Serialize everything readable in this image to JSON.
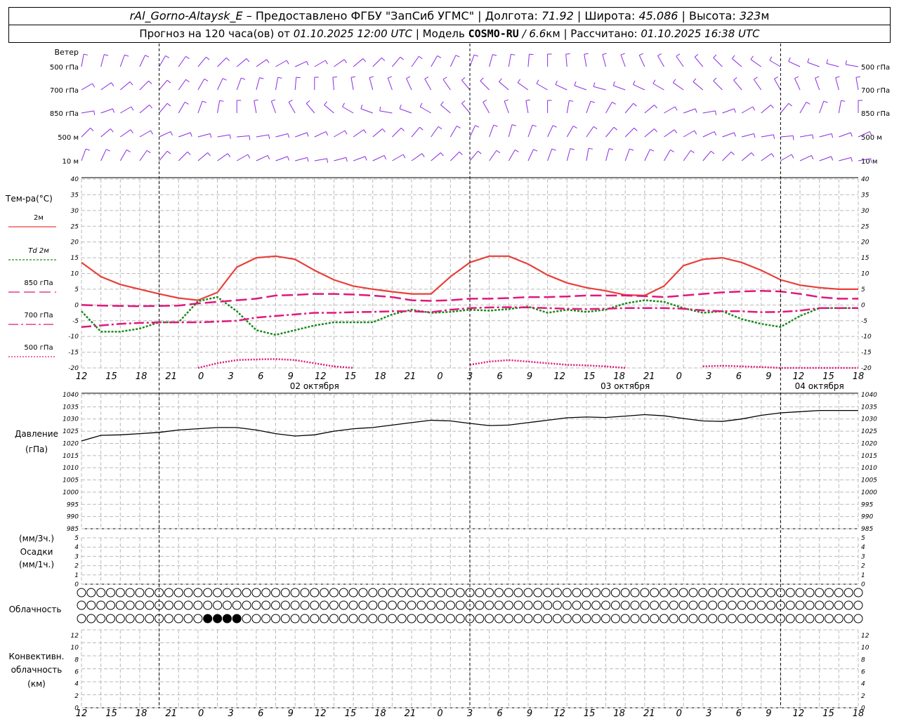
{
  "header": {
    "station": "rAl_Gorno-Altaysk_E",
    "provider": "–  Предоставлено ФГБУ \"ЗапСиб УГМС\"",
    "lon_label": "Долгота:",
    "lon_value": "71.92",
    "lat_label": "Широта:",
    "lat_value": "45.086",
    "alt_label": "Высота:",
    "alt_value": "323",
    "alt_unit": "м",
    "forecast_text": "Прогноз на 120 часа(ов) от",
    "forecast_start": "01.10.2025 12:00 UTC",
    "model_label": "Модель",
    "model_name": "COSMO-RU",
    "model_res": "/ 6.6",
    "model_res_unit": "км",
    "computed_label": "Рассчитано:",
    "computed_value": "01.10.2025 16:38 UTC"
  },
  "colors": {
    "wind": "#8a2be2",
    "t2m": "#e8403a",
    "td2m": "#1a8a1a",
    "t850": "#e0187a",
    "t700": "#e0187a",
    "t500": "#e0187a",
    "pressure": "#000000",
    "grid": "#bbbbbb"
  },
  "time_axis": {
    "hour_ticks": [
      "12",
      "15",
      "18",
      "21",
      "0",
      "3",
      "6",
      "9",
      "12",
      "15",
      "18",
      "21",
      "0",
      "3",
      "6",
      "9",
      "12",
      "15",
      "18",
      "21",
      "0",
      "3",
      "6",
      "9",
      "12",
      "15",
      "18"
    ],
    "day_labels": [
      "02 октября",
      "03 октября",
      "04 октября"
    ]
  },
  "wind_panel": {
    "title": "Ветер",
    "levels": [
      "500 гПа",
      "700 гПа",
      "850 гПа",
      "500 м",
      "10 м"
    ],
    "right_levels": [
      "500 гПа",
      "700 гПа",
      "850 гПа",
      "500 м",
      "10 м"
    ]
  },
  "temp_panel": {
    "title": "Тем-ра(°C)",
    "y_ticks": [
      "40",
      "35",
      "30",
      "25",
      "20",
      "15",
      "10",
      "5",
      "0",
      "-5",
      "-10",
      "-15",
      "-20"
    ],
    "legend": [
      {
        "label": "2м",
        "style": "solid"
      },
      {
        "label": "Td  2м",
        "style": "dotted"
      },
      {
        "label": "850 гПа",
        "style": "longdash"
      },
      {
        "label": "700 гПа",
        "style": "dashdot"
      },
      {
        "label": "500 гПа",
        "style": "fine-dotted"
      }
    ]
  },
  "pressure_panel": {
    "title": "Давление",
    "unit": "(гПа)",
    "y_ticks": [
      "1040",
      "1035",
      "1030",
      "1025",
      "1020",
      "1015",
      "1010",
      "1005",
      "1000",
      "995",
      "990",
      "985"
    ]
  },
  "precip_panel": {
    "unit_top": "(мм/3ч.)",
    "title": "Осадки",
    "unit_bottom": "(мм/1ч.)",
    "y_ticks": [
      "5",
      "4",
      "3",
      "2",
      "1",
      "0"
    ]
  },
  "cloud_panel": {
    "title": "Облачность",
    "filled_low": [
      13,
      14,
      15,
      16
    ]
  },
  "conv_panel": {
    "title_1": "Конвективн.",
    "title_2": "облачность",
    "unit": "(км)",
    "y_ticks": [
      "12",
      "10",
      "8",
      "6",
      "4",
      "2",
      "0"
    ]
  },
  "chart_data": [
    {
      "type": "line",
      "title": "Тем-ра(°C)",
      "x": [
        0,
        3,
        6,
        9,
        12,
        15,
        18,
        21,
        24,
        27,
        30,
        33,
        36,
        39,
        42,
        45,
        48,
        51,
        54,
        57,
        60,
        63,
        66,
        69,
        72,
        75,
        78,
        81,
        84,
        87,
        90,
        93,
        96,
        99,
        102,
        105,
        108,
        111,
        114,
        117,
        120
      ],
      "ylim": [
        -20,
        40
      ],
      "series": [
        {
          "name": "2м",
          "values": [
            13.5,
            9,
            6.5,
            5,
            3.5,
            2.2,
            1.5,
            4,
            12,
            15,
            15.5,
            14.5,
            11,
            8,
            6,
            5,
            4.2,
            3.5,
            3.5,
            9,
            13.5,
            15.5,
            15.5,
            13,
            9.5,
            7,
            5.5,
            4.5,
            3.2,
            3,
            6,
            12.5,
            14.5,
            15,
            13.5,
            11,
            8,
            6.3,
            5.5,
            5,
            5
          ]
        },
        {
          "name": "Td  2м",
          "values": [
            -2,
            -8.5,
            -8.5,
            -7.5,
            -5.5,
            -5.5,
            1.2,
            2.5,
            -2,
            -8,
            -9.5,
            -8,
            -6.5,
            -5.5,
            -5.5,
            -5.5,
            -3,
            -1.5,
            -2.5,
            -2.2,
            -1.5,
            -1.8,
            -1.3,
            -0.5,
            -2.5,
            -1.5,
            -2.2,
            -1.5,
            0.5,
            1.5,
            1,
            -1,
            -2.5,
            -2,
            -4.5,
            -6,
            -7,
            -3.5,
            -1,
            -1,
            -1
          ]
        },
        {
          "name": "850 гПа",
          "values": [
            0,
            -0.2,
            -0.3,
            -0.4,
            -0.3,
            -0.2,
            0.5,
            1,
            1.5,
            2,
            3,
            3.2,
            3.5,
            3.5,
            3.3,
            3,
            2.5,
            1.5,
            1.3,
            1.5,
            2,
            2,
            2.2,
            2.5,
            2.5,
            2.7,
            3,
            3,
            3,
            2.8,
            2.5,
            3,
            3.5,
            4,
            4.3,
            4.5,
            4.3,
            3.5,
            2.5,
            2,
            2
          ]
        },
        {
          "name": "700 гПа",
          "values": [
            -7,
            -6.5,
            -6,
            -5.7,
            -5.5,
            -5.5,
            -5.5,
            -5.3,
            -5,
            -4,
            -3.5,
            -3,
            -2.5,
            -2.5,
            -2.3,
            -2.2,
            -2,
            -2,
            -2.3,
            -1.5,
            -1,
            -0.8,
            -0.7,
            -0.8,
            -1,
            -1.2,
            -1.3,
            -1.2,
            -1,
            -1,
            -1,
            -1.2,
            -1.7,
            -2,
            -2,
            -2.3,
            -2.2,
            -1.8,
            -1,
            -1,
            -1
          ]
        },
        {
          "name": "500 гПа",
          "values": [
            null,
            null,
            null,
            null,
            null,
            null,
            -20,
            -18.5,
            -17.5,
            -17.3,
            -17.2,
            -17.5,
            -18.5,
            -19.5,
            -20,
            null,
            null,
            null,
            null,
            null,
            -19,
            -18,
            -17.5,
            -18,
            -18.5,
            -19,
            -19.2,
            -19.5,
            -20,
            null,
            null,
            null,
            -19.5,
            -19.3,
            -19.5,
            -19.7,
            -20,
            -20,
            -20,
            -20,
            -20
          ]
        }
      ]
    },
    {
      "type": "line",
      "title": "Давление",
      "x": [
        0,
        3,
        6,
        9,
        12,
        15,
        18,
        21,
        24,
        27,
        30,
        33,
        36,
        39,
        42,
        45,
        48,
        51,
        54,
        57,
        60,
        63,
        66,
        69,
        72,
        75,
        78,
        81,
        84,
        87,
        90,
        93,
        96,
        99,
        102,
        105,
        108,
        111,
        114,
        117,
        120
      ],
      "ylim": [
        985,
        1040
      ],
      "series": [
        {
          "name": "",
          "values": [
            1021,
            1023.3,
            1023.5,
            1024,
            1024.5,
            1025.5,
            1026,
            1026.5,
            1026.5,
            1025.5,
            1024,
            1023,
            1023.5,
            1025,
            1026,
            1026.5,
            1027.5,
            1028.5,
            1029.5,
            1029.2,
            1028.2,
            1027.3,
            1027.5,
            1028.5,
            1029.5,
            1030.5,
            1030.8,
            1030.6,
            1031.2,
            1031.8,
            1031.3,
            1030.2,
            1029.2,
            1029,
            1030,
            1031.5,
            1032.5,
            1033,
            1033.5,
            1033.5,
            1033.5
          ]
        }
      ]
    }
  ]
}
